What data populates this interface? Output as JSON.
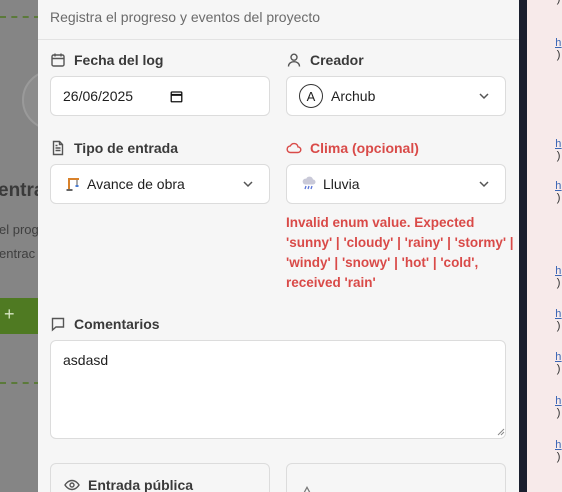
{
  "modal": {
    "subtitle": "Registra el progreso y eventos del proyecto",
    "date": {
      "label": "Fecha del log",
      "value": "26/06/2025"
    },
    "creator": {
      "label": "Creador",
      "avatar_initial": "A",
      "value": "Archub"
    },
    "entry_type": {
      "label": "Tipo de entrada",
      "value": "Avance de obra",
      "icon": "construction-crane-emoji"
    },
    "weather": {
      "label": "Clima (opcional)",
      "value": "Lluvia",
      "icon": "rain-cloud-emoji",
      "error": "Invalid enum value. Expected 'sunny' | 'cloudy' | 'rainy' | 'stormy' | 'windy' | 'snowy' | 'hot' | 'cold', received 'rain'"
    },
    "comments": {
      "label": "Comentarios",
      "value": "asdasd"
    },
    "public_entry": {
      "label": "Entrada pública"
    }
  },
  "background": {
    "title_fragment": "entra",
    "line1_fragment": "el prog",
    "line2_fragment": "entrac",
    "button_fragment": "+"
  },
  "colors": {
    "error": "#d94a48",
    "modal_bg": "#f6f6f6",
    "overlay": "#7a7a7a"
  }
}
